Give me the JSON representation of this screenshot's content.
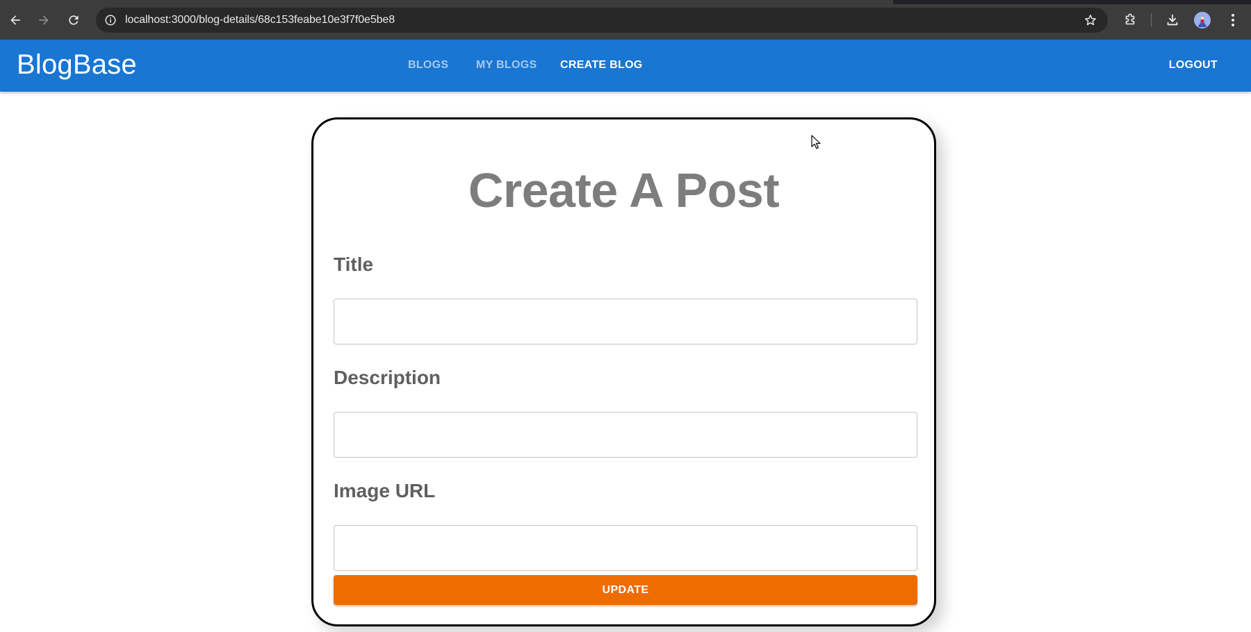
{
  "browser": {
    "url": "localhost:3000/blog-details/68c153feabe10e3f7f0e5be8",
    "icons": [
      "back-arrow-icon",
      "forward-arrow-icon",
      "reload-icon",
      "site-info-icon",
      "bookmark-star-icon",
      "extensions-icon",
      "downloads-icon",
      "profile-avatar",
      "menu-kebab-icon"
    ]
  },
  "appbar": {
    "brand": "BlogBase",
    "nav": [
      {
        "label": "BLOGS",
        "state": "inactive"
      },
      {
        "label": "MY BLOGS",
        "state": "inactive"
      },
      {
        "label": "CREATE BLOG",
        "state": "active"
      }
    ],
    "logout": "LOGOUT",
    "color": "#1976d2"
  },
  "form": {
    "title": "Create A Post",
    "fields": [
      {
        "label": "Title",
        "value": "",
        "placeholder": ""
      },
      {
        "label": "Description",
        "value": "",
        "placeholder": ""
      },
      {
        "label": "Image URL",
        "value": "",
        "placeholder": ""
      }
    ],
    "submit_label": "UPDATE",
    "submit_color": "#ef6c00"
  }
}
